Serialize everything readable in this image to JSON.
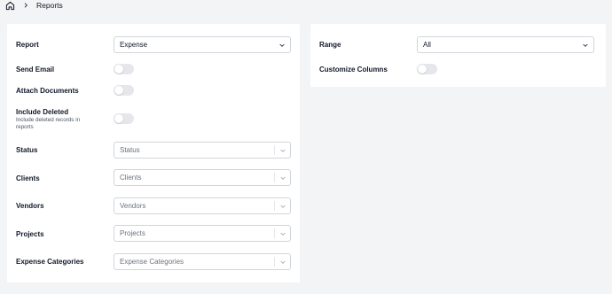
{
  "breadcrumb": {
    "home_icon": "home-icon",
    "separator_icon": "chevron-right-icon",
    "current": "Reports"
  },
  "left_panel": {
    "report": {
      "label": "Report",
      "value": "Expense"
    },
    "send_email": {
      "label": "Send Email",
      "enabled": false
    },
    "attach_documents": {
      "label": "Attach Documents",
      "enabled": false
    },
    "include_deleted": {
      "label": "Include Deleted",
      "description": "Include deleted records in reports",
      "enabled": false
    },
    "status": {
      "label": "Status",
      "placeholder": "Status"
    },
    "clients": {
      "label": "Clients",
      "placeholder": "Clients"
    },
    "vendors": {
      "label": "Vendors",
      "placeholder": "Vendors"
    },
    "projects": {
      "label": "Projects",
      "placeholder": "Projects"
    },
    "expense_categories": {
      "label": "Expense Categories",
      "placeholder": "Expense Categories"
    }
  },
  "right_panel": {
    "range": {
      "label": "Range",
      "value": "All"
    },
    "customize_columns": {
      "label": "Customize Columns",
      "enabled": false
    }
  },
  "colors": {
    "background": "#f3f4f6",
    "panel": "#ffffff",
    "border": "#d1d5db",
    "toggle_off": "#e5e7eb"
  }
}
